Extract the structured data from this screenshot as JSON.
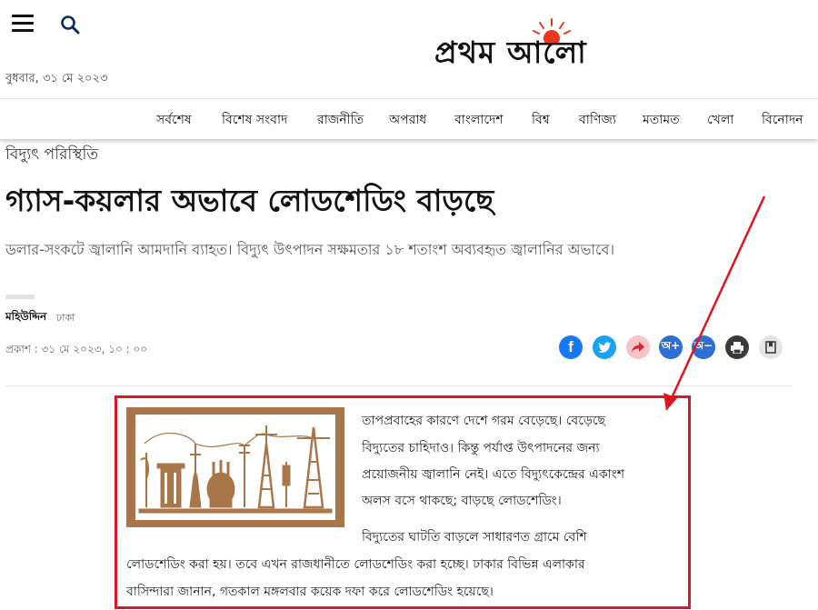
{
  "header": {
    "menu_icon": "hamburger-icon",
    "search_icon": "search-icon",
    "logo_text": "প্রথম আলো",
    "date": "বুধবার, ৩১ মে ২০২৩"
  },
  "nav": {
    "items": [
      "সর্বশেষ",
      "বিশেষ সংবাদ",
      "রাজনীতি",
      "অপরাধ",
      "বাংলাদেশ",
      "বিশ্ব",
      "বাণিজ্য",
      "মতামত",
      "খেলা",
      "বিনোদন"
    ]
  },
  "article": {
    "category": "বিদ্যুৎ পরিস্থিতি",
    "headline": "গ্যাস-কয়লার অভাবে লোডশেডিং বাড়ছে",
    "subheadline": "ডলার-সংকটে জ্বালানি আমদানি ব্যাহত। বিদ্যুৎ উৎপাদন সক্ষমতার ১৮ শতাংশ অব্যবহৃত জ্বালানির অভাবে।",
    "author": "মহিউদ্দিন",
    "location": "ঢাকা",
    "published": "প্রকাশ : ৩১ মে ২০২৩, ১০ : ০০",
    "body_lines": [
      "তাপপ্রবাহের কারণে দেশে গরম বেড়েছে। বেড়েছে",
      "বিদ্যুতের চাহিদাও। কিন্তু পর্যাপ্ত উৎপাদনের জন্য",
      "প্রয়োজনীয় জ্বালানি নেই। এতে বিদ্যুৎকেন্দ্রের একাংশ",
      "অলস বসে থাকছে; বাড়ছে লোডশেডিং।",
      "বিদ্যুতের ঘাটতি বাড়লে সাধারণত গ্রামে বেশি",
      "লোডশেডিং করা হয়। তবে এখন রাজধানীতে লোডশেডিং করা হচ্ছে। ঢাকার বিভিন্ন এলাকার",
      "বাসিন্দারা জানান, গতকাল মঙ্গলবার কয়েক দফা করে লোডশেডিং হয়েছে।"
    ]
  },
  "share": {
    "icons": [
      "facebook-icon",
      "twitter-icon",
      "share-icon",
      "font-increase-icon",
      "font-decrease-icon",
      "print-icon",
      "bookmark-icon"
    ],
    "font_increase_label": "অ+",
    "font_decrease_label": "অ−"
  },
  "colors": {
    "annotation_red": "#e0141e",
    "logo_sun": "#e8381d",
    "facebook": "#1877f2",
    "twitter": "#1da1f2",
    "share_bg": "#f7c5c8",
    "font_btn": "#2d6fd6",
    "print_btn": "#3a3a3a",
    "illustration_bg": "#a9764a"
  }
}
